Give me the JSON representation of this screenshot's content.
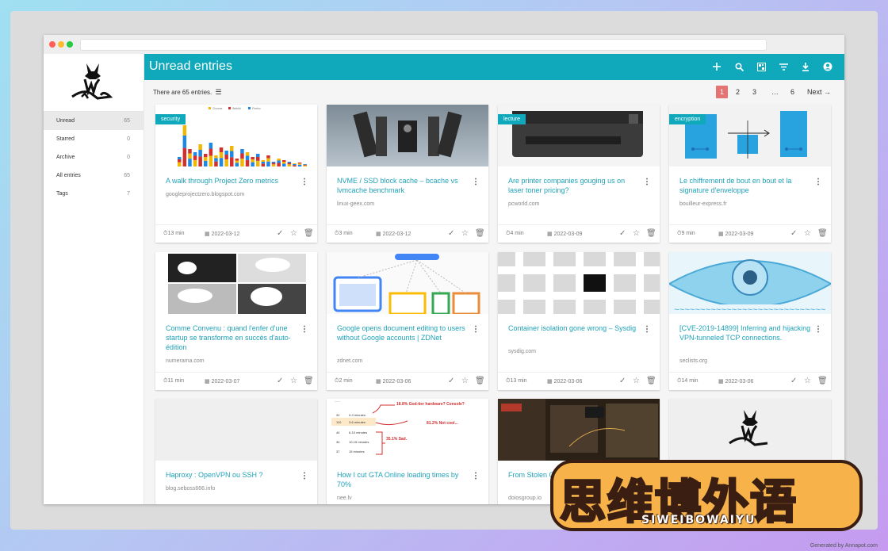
{
  "app": {
    "title": "Unread entries"
  },
  "sidebar": {
    "items": [
      {
        "label": "Unread",
        "count": "65"
      },
      {
        "label": "Starred",
        "count": "0"
      },
      {
        "label": "Archive",
        "count": "0"
      },
      {
        "label": "All entries",
        "count": "65"
      },
      {
        "label": "Tags",
        "count": "7"
      }
    ]
  },
  "toolbar": {
    "icons": [
      "plus-icon",
      "search-icon",
      "qr-icon",
      "filter-icon",
      "download-icon",
      "account-icon"
    ]
  },
  "summary": {
    "text": "There are 65 entries."
  },
  "pagination": {
    "pages": [
      "1",
      "2",
      "3",
      "…",
      "6"
    ],
    "next": "Next →"
  },
  "entries": [
    {
      "title": "A walk through Project Zero metrics",
      "domain": "googleprojectzero.blogspot.com",
      "tag": "security",
      "reading_time": "13 min",
      "date": "2022-03-12"
    },
    {
      "title": "NVME / SSD block cache – bcache vs lvmcache benchmark",
      "domain": "linux-geex.com",
      "tag": "",
      "reading_time": "3 min",
      "date": "2022-03-12"
    },
    {
      "title": "Are printer companies gouging us on laser toner pricing?",
      "domain": "pcworld.com",
      "tag": "lecture",
      "reading_time": "4 min",
      "date": "2022-03-09"
    },
    {
      "title": "Le chiffrement de bout en bout et la signature d'enveloppe",
      "domain": "bouilleur-express.fr",
      "tag": "encryption",
      "reading_time": "9 min",
      "date": "2022-03-09"
    },
    {
      "title": "Comme Convenu : quand l'enfer d'une startup se transforme en succès d'auto-édition",
      "domain": "numerama.com",
      "tag": "",
      "reading_time": "11 min",
      "date": "2022-03-07"
    },
    {
      "title": "Google opens document editing to users without Google accounts | ZDNet",
      "domain": "zdnet.com",
      "tag": "",
      "reading_time": "2 min",
      "date": "2022-03-06"
    },
    {
      "title": "Container isolation gone wrong – Sysdig",
      "domain": "sysdig.com",
      "tag": "",
      "reading_time": "13 min",
      "date": "2022-03-06"
    },
    {
      "title": "[CVE-2019-14899] Inferring and hijacking VPN-tunneled TCP connections.",
      "domain": "seclists.org",
      "tag": "",
      "reading_time": "14 min",
      "date": "2022-03-06"
    },
    {
      "title": "Haproxy : OpenVPN ou SSH ?",
      "domain": "blog.seboss666.info",
      "tag": "",
      "reading_time": "",
      "date": ""
    },
    {
      "title": "How I cut GTA Online loading times by 70%",
      "domain": "nee.lv",
      "tag": "",
      "reading_time": "",
      "date": ""
    },
    {
      "title": "From Stolen Company N",
      "domain": "doiosgroup.io",
      "tag": "",
      "reading_time": "",
      "date": ""
    },
    {
      "title": "",
      "domain": "",
      "tag": "",
      "reading_time": "",
      "date": ""
    }
  ],
  "thumb_text": {
    "legend": [
      "Chrome",
      "Webkit",
      "Firefox"
    ],
    "gta_annot1": "18.8% God-tier hardware? Console?",
    "gta_annot2": "81.2% Not cool...",
    "gta_annot3": "35.1% Sad.",
    "gta_counts": [
      "32",
      "110",
      "44",
      "34",
      "37"
    ],
    "gta_ranges": [
      "0-3 minutes",
      "3-6 minutes",
      "6-10 minutes",
      "10-15 minutes",
      "15 minutes"
    ]
  },
  "watermark": {
    "main": "思维博外语",
    "sub": "SIWEIBOWAIYU"
  },
  "credit": "Generated by Annapot.com",
  "colors": {
    "accent": "#0fa9bb",
    "pager_active": "#e57373"
  }
}
